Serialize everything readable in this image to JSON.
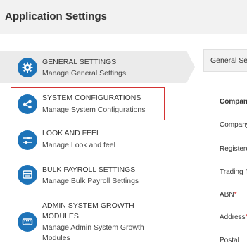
{
  "page": {
    "title": "Application Settings"
  },
  "sidebar": {
    "items": [
      {
        "title": "GENERAL SETTINGS",
        "subtitle": "Manage General Settings",
        "icon": "gear-icon",
        "active": true
      },
      {
        "title": "SYSTEM CONFIGURATIONS",
        "subtitle": "Manage System Configurations",
        "icon": "share-nodes-icon",
        "highlighted": true
      },
      {
        "title": "LOOK AND FEEL",
        "subtitle": "Manage Look and feel",
        "icon": "sliders-icon"
      },
      {
        "title": "BULK PAYROLL SETTINGS",
        "subtitle": "Manage Bulk Payroll Settings",
        "icon": "window-icon"
      },
      {
        "title_line1": "ADMIN SYSTEM GROWTH",
        "title_line2": "MODULES",
        "subtitle_line1": "Manage Admin System Growth",
        "subtitle_line2": "Modules",
        "icon": "keyboard-icon"
      }
    ]
  },
  "panel": {
    "tab_label": "General Settings",
    "section_title": "Company",
    "fields": [
      {
        "label": "Company",
        "required": false
      },
      {
        "label": "Registered",
        "required": false
      },
      {
        "label": "Trading N",
        "required": false
      },
      {
        "label": "ABN",
        "required": true
      },
      {
        "label": "Address",
        "required": true
      },
      {
        "label": "Postal",
        "required": false
      }
    ]
  },
  "colors": {
    "accent": "#1d73b8",
    "highlight": "#d43333",
    "active_bg": "#ebebeb"
  }
}
